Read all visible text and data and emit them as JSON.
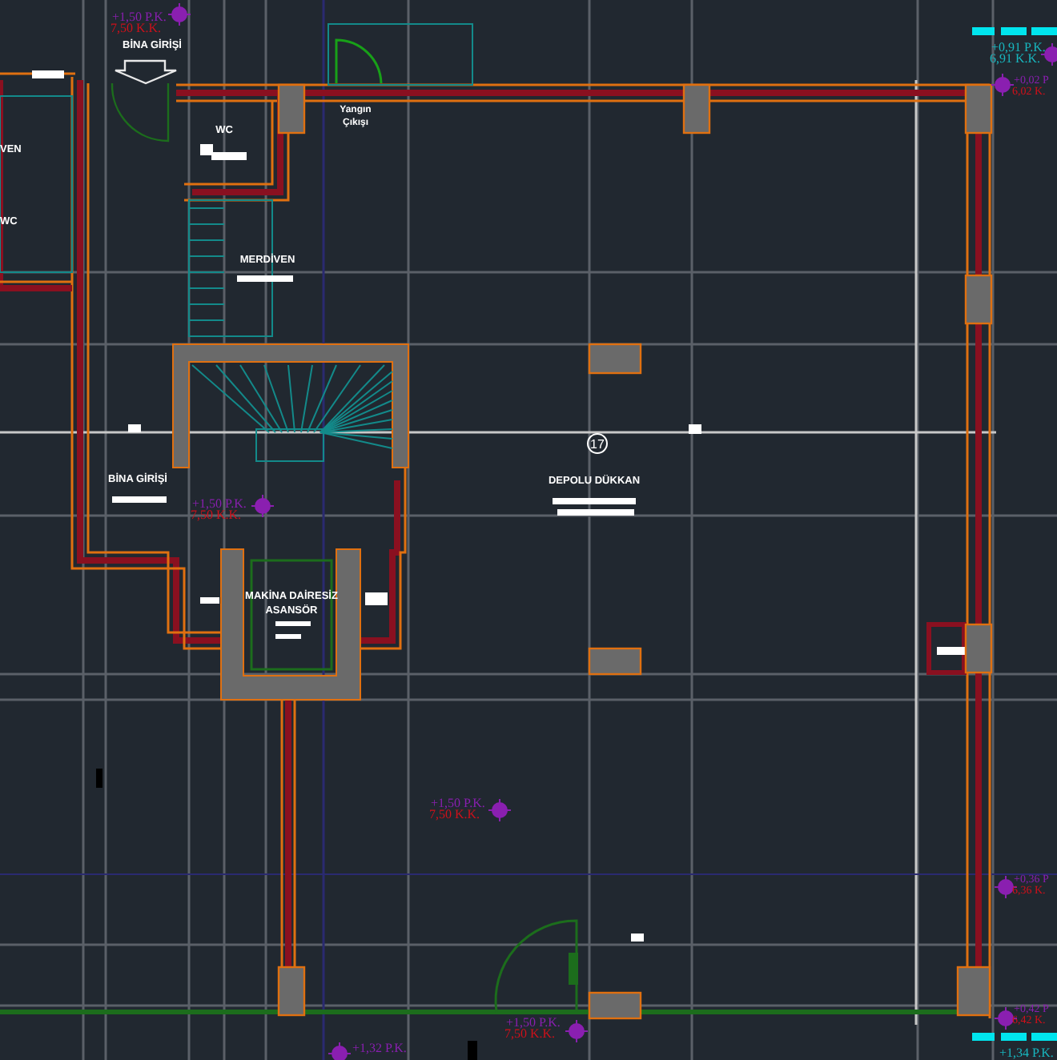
{
  "labels": [
    {
      "kind": "label",
      "text": "BİNA GİRİŞİ"
    },
    {
      "kind": "small",
      "text": "Yangın"
    },
    {
      "kind": "small",
      "text": "Çıkışı"
    },
    {
      "kind": "label",
      "text": "WC"
    },
    {
      "kind": "label",
      "text": "VEN"
    },
    {
      "kind": "label",
      "text": "WC"
    },
    {
      "kind": "label",
      "text": "MERDİVEN"
    },
    {
      "kind": "room_number",
      "text": "17"
    },
    {
      "kind": "label",
      "text": "BİNA GİRİŞİ"
    },
    {
      "kind": "label",
      "text": "DEPOLU DÜKKAN"
    },
    {
      "kind": "label",
      "text": "MAKİNA DAİRESİZ"
    },
    {
      "kind": "label",
      "text": "ASANSÖR"
    }
  ],
  "elevations": [
    {
      "pk": "+1,50 P.K.",
      "kk": "7,50 K.K.",
      "color": "#8a1fb0"
    },
    {
      "pk": "+0,91 P.K.",
      "kk": "6,91 K.K.",
      "color": "#18b8c0"
    },
    {
      "pk": "+0,02 P",
      "kk": "6,02 K.",
      "color": "#8a1fb0"
    },
    {
      "pk": "+1,50 P.K.",
      "kk": "7,50 K.K.",
      "color": "#8a1fb0"
    },
    {
      "pk": "+1,50 P.K.",
      "kk": "7,50 K.K.",
      "color": "#8a1fb0"
    },
    {
      "pk": "+1,50 P.K.",
      "kk": "7,50 K.K.",
      "color": "#8a1fb0"
    },
    {
      "pk": "+0,36 P",
      "kk": "6,36 K.",
      "color": "#8a1fb0"
    },
    {
      "pk": "+0,42 P",
      "kk": "6,42 K.",
      "color": "#8a1fb0"
    },
    {
      "pk": "+1,34 P.K.",
      "color": "#18b8c0"
    },
    {
      "pk": "+1,32 P.K.",
      "color": "#8a1fb0"
    }
  ]
}
